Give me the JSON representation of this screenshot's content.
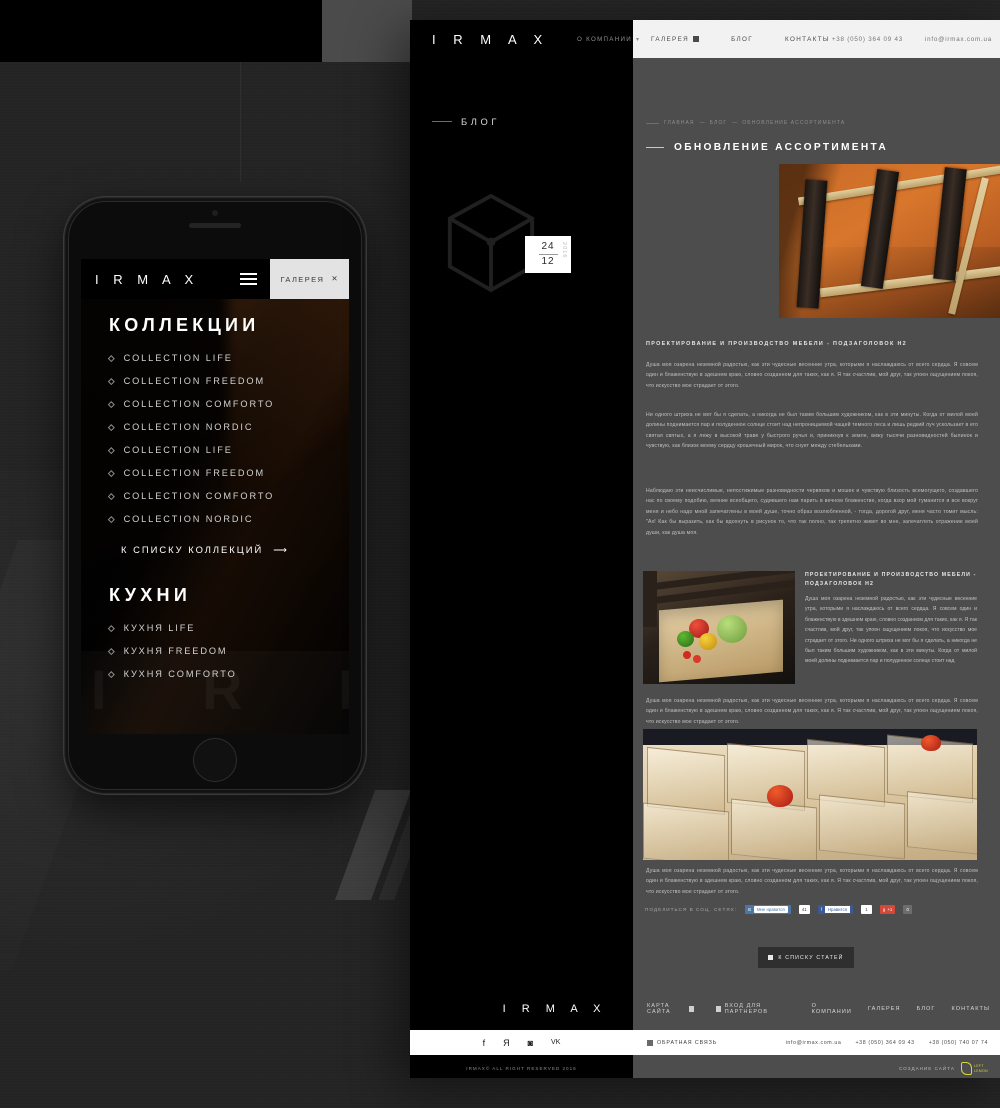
{
  "brand": {
    "name": "I R M A X",
    "name_footer": "I R M A X"
  },
  "phone": {
    "topbar": {
      "logo": "I R M A X",
      "menu_icon": "hamburger-icon",
      "gallery_label": "ГАЛЕРЕЯ",
      "close_icon": "✕"
    },
    "collections": {
      "heading": "КОЛЛЕКЦИИ",
      "items": [
        "COLLECTION LIFE",
        "COLLECTION FREEDOM",
        "COLLECTION COMFORTO",
        "COLLECTION NORDIC",
        "COLLECTION LIFE",
        "COLLECTION FREEDOM",
        "COLLECTION COMFORTO",
        "COLLECTION NORDIC"
      ],
      "more_label": "К СПИСКУ КОЛЛЕКЦИЙ",
      "more_arrow": "⟶"
    },
    "kitchens": {
      "heading": "КУХНИ",
      "items": [
        "КУХНЯ LIFE",
        "КУХНЯ FREEDOM",
        "КУХНЯ COMFORTO"
      ]
    },
    "watermark": "I R M"
  },
  "desktop": {
    "header": {
      "logo": "I R M A X",
      "about_label": "О КОМПАНИИ",
      "about_caret": "▾",
      "nav": [
        {
          "label": "ГАЛЕРЕЯ",
          "icon": "grid-icon"
        },
        {
          "label": "БЛОГ",
          "icon": ""
        },
        {
          "label": "КОНТАКТЫ",
          "icon": ""
        }
      ],
      "phone": "+38 (050) 364 09 43",
      "email": "info@irmax.com.ua"
    },
    "sidebar": {
      "section_label": "БЛОГ",
      "logo_icon": "cube-icon",
      "date": {
        "day": "24",
        "month": "12",
        "year": "2016"
      }
    },
    "article": {
      "breadcrumb": [
        "ГЛАВНАЯ",
        "БЛОГ",
        "ОБНОВЛЕНИЕ АССОРТИМЕНТА"
      ],
      "breadcrumb_sep": "—",
      "title": "ОБНОВЛЕНИЕ АССОРТИМЕНТА",
      "hero_alt": "wooden-luggage-rack-photo",
      "subheading_1": "ПРОЕКТИРОВАНИЕ И ПРОИЗВОДСТВО МЕБЕЛИ - ПОДЗАГОЛОВОК Н2",
      "paragraph_1": "Душа моя озарена неземной радостью, как  эти чудесные весенние утра, которыми я наслаждаюсь от всего сердца. Я совсем один и блаженствую в здешнем краю, словно созданном для таких, как я. Я так счастлив, мой друг, так упоен ощущением покоя, что искусство мое страдает  от этого.",
      "paragraph_2": "Ни одного штриха не мог бы я сделать, а никогда не был таким большим художником, как в эти минуты. Когда от милой моей долины поднимается пар  и полуденное солнце стоит над непроницаемой чащей темного леса и лишь редкий луч ускользает в его святая святых, а я лежу в высокой траве у быстрого ручья и, приникнув к земле, вижу тысячи разновидностей былинок и чувствую, как близок моему сердцу крошечный мирок, что снует между стебельками.",
      "paragraph_3": "Наблюдаю эти неисчислимые, непостижимые разновидности червяков и мошек и чувствую близость всемогущего, создавшего нас по своему подобию, веяние всеобщего, судившего нам парить в вечном блаженстве, когда взор мой туманится и все вокруг меня и небо надо мной запечатлены в моей душе, точно образ возлюбленной, - тогда, дорогой друг, меня часто томит мысль: \"Ах! Как бы выразить, как бы вдохнуть в рисунок то, что так полно, так трепетно живет во мне, запечатлеть отражение моей души, как душа моя.",
      "subheading_2": "ПРОЕКТИРОВАНИЕ И ПРОИЗВОДСТВО МЕБЕЛИ - ПОДЗАГОЛОВОК Н2",
      "paragraph_4": "Душа моя озарена неземной радостью, как  эти чудесные весенние утра, которыми я наслаждаюсь от всего сердца. Я совсем один и блаженствую в здешнем краю, словно созданном для таких, как я. Я так счастлив, мой друг, так упоен ощущением покоя, что искусство мое страдает от этого. Ни одного штриха не мог бы я сделать, а никогда не был таким большим художником, как в эти минуты. Когда от милой моей долины поднимается пар  и полуденное солнце стоит над",
      "paragraph_5": "Душа моя озарена неземной радостью, как  эти чудесные весенние утра, которыми я наслаждаюсь от всего сердца. Я совсем один и блаженствую в здешнем краю, словно созданном для таких, как я. Я так счастлив, мой друг, так упоен ощущением покоя, что искусство мое страдает от этого.",
      "image_veg_alt": "wooden-crate-with-vegetables-photo",
      "image_boxes_alt": "wooden-divided-boxes-photo",
      "paragraph_6": "Душа моя озарена неземной радостью, как  эти чудесные весенние утра, которыми я наслаждаюсь от всего сердца. Я совсем один и блаженствую в здешнем краю, словно созданном для таких, как я. Я так счастлив, мой друг, так упоен ощущением покоя, что искусство мое страдает от этого.",
      "share": {
        "label": "ПОДЕЛИТЬСЯ В СОЦ. СЕТЯХ:",
        "vk_label": "Мне нравится",
        "vk_count": "41",
        "fb_label": "Нравится",
        "fb_count": "1",
        "gp_label": "+1",
        "gp_count": "0"
      },
      "back_button": {
        "label": "К СПИСКУ СТАТЕЙ",
        "icon": "list-icon"
      }
    },
    "footer": {
      "logo": "I R M A X",
      "sitemap": "КАРТА САЙТА",
      "sitemap_icon": "map-icon",
      "partners": "ВХОД ДЛЯ ПАРТНЕРОВ",
      "partners_icon": "lock-icon",
      "nav": [
        "О КОМПАНИИ",
        "ГАЛЕРЕЯ",
        "БЛОГ",
        "КОНТАКТЫ"
      ],
      "social": [
        {
          "name": "facebook-icon",
          "glyph": "f"
        },
        {
          "name": "yandex-icon",
          "glyph": "Я"
        },
        {
          "name": "instagram-icon",
          "glyph": "◙"
        },
        {
          "name": "vk-icon",
          "glyph": "VK"
        }
      ],
      "feedback": "ОБРАТНАЯ СВЯЗЬ",
      "feedback_icon": "chat-icon",
      "email": "info@irmax.com.ua",
      "phone1": "+38 (050) 364 09 43",
      "phone2": "+38 (050) 740 07 74",
      "copyright": "IRMAX© ALL RIGHT RESERVED 2016",
      "madeby_label": "СОЗДАНИЕ САЙТА",
      "madeby_brand_1": "LEFT",
      "madeby_brand_2": "LEMON"
    }
  },
  "colors": {
    "background": "#242424",
    "panel": "#4d4d4d",
    "black": "#000000",
    "accent_yellow": "#d8d83a",
    "vk_blue": "#4a76a8",
    "fb_blue": "#3b5998",
    "gp_red": "#d34836"
  }
}
